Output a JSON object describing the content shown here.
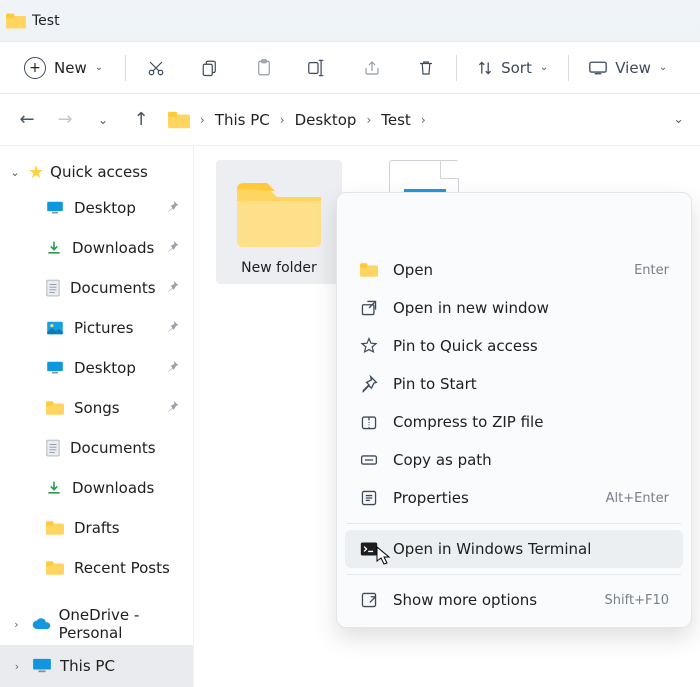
{
  "window": {
    "title": "Test"
  },
  "toolbar": {
    "new_label": "New",
    "sort_label": "Sort",
    "view_label": "View"
  },
  "breadcrumb": {
    "segments": [
      "This PC",
      "Desktop",
      "Test"
    ]
  },
  "sidebar": {
    "quick_access_label": "Quick access",
    "items": [
      {
        "label": "Desktop",
        "icon": "monitor",
        "pinned": true
      },
      {
        "label": "Downloads",
        "icon": "download",
        "pinned": true
      },
      {
        "label": "Documents",
        "icon": "document",
        "pinned": true
      },
      {
        "label": "Pictures",
        "icon": "picture",
        "pinned": true
      },
      {
        "label": "Desktop",
        "icon": "monitor",
        "pinned": true
      },
      {
        "label": "Songs",
        "icon": "folder",
        "pinned": true
      },
      {
        "label": "Documents",
        "icon": "document",
        "pinned": false
      },
      {
        "label": "Downloads",
        "icon": "download",
        "pinned": false
      },
      {
        "label": "Drafts",
        "icon": "folder",
        "pinned": false
      },
      {
        "label": "Recent Posts",
        "icon": "folder",
        "pinned": false
      }
    ],
    "onedrive_label": "OneDrive - Personal",
    "thispc_label": "This PC"
  },
  "content": {
    "items": [
      {
        "label": "New folder",
        "type": "folder",
        "selected": true
      }
    ]
  },
  "context_menu": {
    "items": [
      {
        "label": "Open",
        "shortcut": "Enter",
        "icon": "folder"
      },
      {
        "label": "Open in new window",
        "shortcut": "",
        "icon": "new-window"
      },
      {
        "label": "Pin to Quick access",
        "shortcut": "",
        "icon": "star-outline"
      },
      {
        "label": "Pin to Start",
        "shortcut": "",
        "icon": "pin"
      },
      {
        "label": "Compress to ZIP file",
        "shortcut": "",
        "icon": "zip"
      },
      {
        "label": "Copy as path",
        "shortcut": "",
        "icon": "path"
      },
      {
        "label": "Properties",
        "shortcut": "Alt+Enter",
        "icon": "properties"
      },
      {
        "label": "Open in Windows Terminal",
        "shortcut": "",
        "icon": "terminal",
        "hover": true
      },
      {
        "label": "Show more options",
        "shortcut": "Shift+F10",
        "icon": "more"
      }
    ]
  }
}
